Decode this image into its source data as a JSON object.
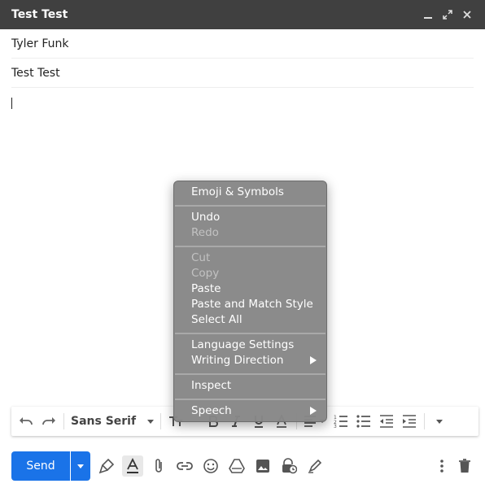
{
  "window": {
    "title": "Test Test"
  },
  "compose": {
    "to": "Tyler Funk",
    "subject": "Test Test",
    "body": ""
  },
  "format_bar": {
    "font": "Sans Serif"
  },
  "send": {
    "label": "Send"
  },
  "context_menu": {
    "items": [
      {
        "label": "Emoji & Symbols",
        "enabled": true
      },
      {
        "label": "Undo",
        "enabled": true
      },
      {
        "label": "Redo",
        "enabled": false
      },
      {
        "label": "Cut",
        "enabled": false
      },
      {
        "label": "Copy",
        "enabled": false
      },
      {
        "label": "Paste",
        "enabled": true
      },
      {
        "label": "Paste and Match Style",
        "enabled": true
      },
      {
        "label": "Select All",
        "enabled": true
      },
      {
        "label": "Language Settings",
        "enabled": true
      },
      {
        "label": "Writing Direction",
        "enabled": true,
        "submenu": true
      },
      {
        "label": "Inspect",
        "enabled": true
      },
      {
        "label": "Speech",
        "enabled": true,
        "submenu": true
      }
    ]
  },
  "icons": {
    "titlebar": [
      "minimize-icon",
      "fullscreen-icon",
      "close-icon"
    ],
    "bottom": [
      "formatting-options-icon",
      "text-color-icon",
      "attach-icon",
      "link-icon",
      "emoji-icon",
      "drive-icon",
      "photo-icon",
      "confidential-icon",
      "signature-icon",
      "more-options-icon",
      "trash-icon"
    ]
  },
  "colors": {
    "titlebar": "#404040",
    "send": "#1a73e8",
    "menu": "#878787"
  }
}
